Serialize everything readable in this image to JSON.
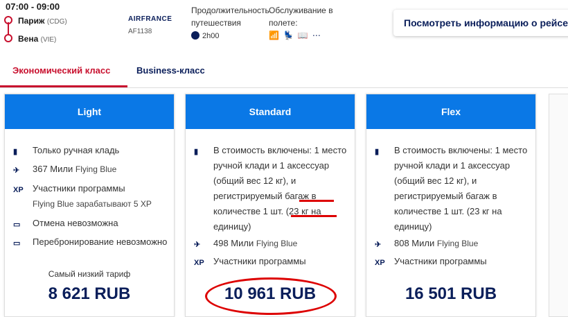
{
  "flight": {
    "times": "07:00 - 09:00",
    "origin_city": "Париж",
    "origin_code": "(CDG)",
    "dest_city": "Вена",
    "dest_code": "(VIE)",
    "airline": "AIRFRANCE",
    "flight_number": "AF1138",
    "duration_label": "Продолжительность путешествия",
    "duration_value": "2h00",
    "service_label": "Обслуживание в полете:",
    "info_button": "Посмотреть информацию о рейсе"
  },
  "tabs": {
    "economy": "Экономический класс",
    "business": "Business-класс"
  },
  "fares": [
    {
      "name": "Light",
      "features": [
        {
          "icon": "bag-icon",
          "text": "Только ручная кладь"
        },
        {
          "icon": "miles-icon",
          "text": "367 Мили",
          "sub": "Flying Blue"
        },
        {
          "icon": "xp-icon",
          "text": "Участники программы",
          "sub": "Flying Blue зарабатывают 5 XP"
        },
        {
          "icon": "ticket-icon",
          "text": "Отмена невозможна"
        },
        {
          "icon": "rebook-icon",
          "text": "Перебронирование невозможно"
        }
      ],
      "price_note": "Самый низкий тариф",
      "price": "8 621 RUB"
    },
    {
      "name": "Standard",
      "features": [
        {
          "icon": "bag-icon",
          "text": "В стоимость включены: 1 место ручной клади и 1 аксессуар (общий вес 12 кг), и регистрируемый багаж в количестве 1 шт. (23 кг на единицу)"
        },
        {
          "icon": "miles-icon",
          "text": "498 Мили",
          "sub": "Flying Blue"
        },
        {
          "icon": "xp-icon",
          "text": "Участники программы"
        }
      ],
      "price": "10 961 RUB"
    },
    {
      "name": "Flex",
      "features": [
        {
          "icon": "bag-icon",
          "text": "В стоимость включены: 1 место ручной клади и 1 аксессуар (общий вес 12 кг), и регистрируемый багаж в количестве 1 шт. (23 кг на единицу)"
        },
        {
          "icon": "miles-icon",
          "text": "808 Мили",
          "sub": "Flying Blue"
        },
        {
          "icon": "xp-icon",
          "text": "Участники программы"
        }
      ],
      "price": "16 501 RUB"
    }
  ],
  "colors": {
    "accent_red": "#c8102e",
    "brand_blue": "#0a78e6",
    "navy": "#0a1e5a",
    "annotation_red": "#d00"
  }
}
